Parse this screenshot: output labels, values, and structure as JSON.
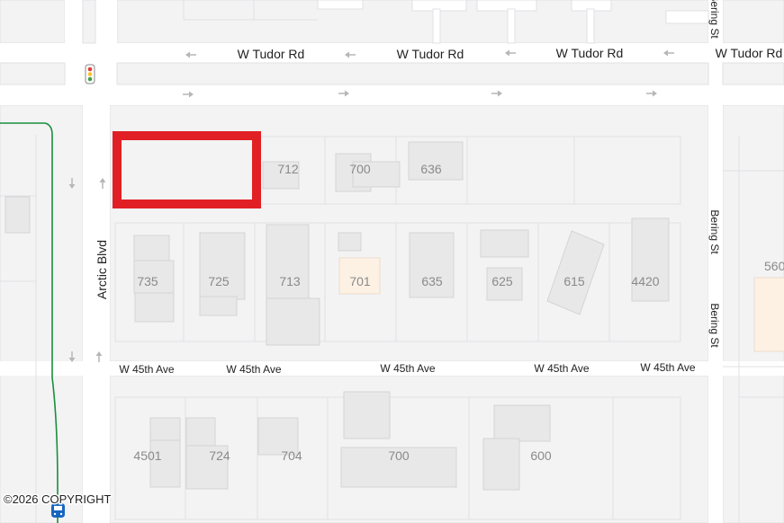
{
  "colors": {
    "background": "#f3f3f4",
    "road": "#ffffff",
    "block_border": "#e1e1e4",
    "building": "#e8e8e8",
    "building_edge": "#d4d4d4",
    "highlight_building": "#fdf1e4",
    "selection": "#e12025",
    "transit_line": "#1a8f3c",
    "arrow": "#b6b6b8"
  },
  "streets": {
    "tudor": "W Tudor Rd",
    "arctic": "Arctic Blvd",
    "bering": "Bering St",
    "ave45": "W 45th Ave"
  },
  "lots": {
    "n712": "712",
    "n700a": "700",
    "n636": "636",
    "n735": "735",
    "n725": "725",
    "n713": "713",
    "n701": "701",
    "n635": "635",
    "n625": "625",
    "n615": "615",
    "n4420": "4420",
    "n4501": "4501",
    "n724": "724",
    "n704": "704",
    "n700b": "700",
    "n600": "600",
    "n560": "560"
  },
  "icons": {
    "traffic_light": "traffic-light-icon",
    "bus": "bus-icon"
  },
  "copyright": "©2026 COPYRIGHT"
}
